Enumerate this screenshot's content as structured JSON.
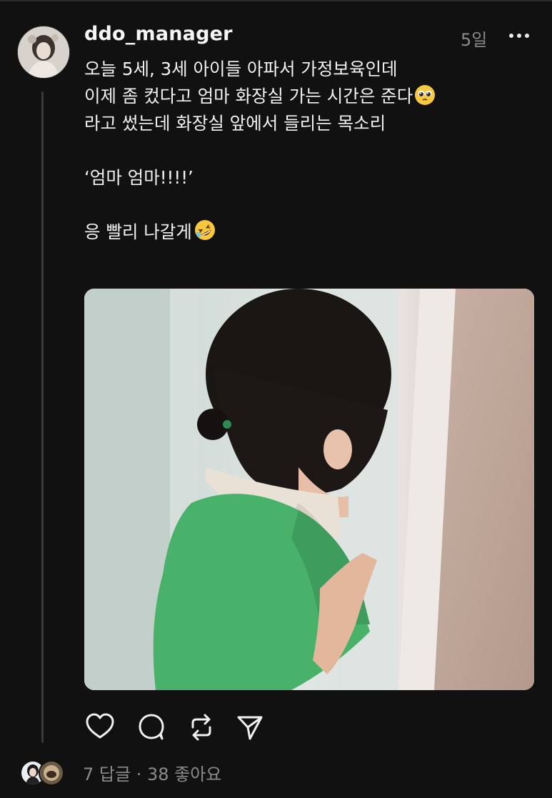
{
  "post": {
    "username": "ddo_manager",
    "time_ago": "5일",
    "text": {
      "line1": "오늘 5세, 3세 아이들 아파서 가정보육인데",
      "line2": "이제 좀 컸다고 엄마 화장실 가는 시간은 준다",
      "line3": "라고 썼는데 화장실 앞에서 들리는 목소리",
      "line4": "‘엄마 엄마!!!!’",
      "line5": "응 빨리 나갈게"
    },
    "emojis": {
      "line2_end": "pleading-face",
      "line5_end": "rolling-on-floor-laughing-face"
    }
  },
  "actions": {
    "like": "heart-icon",
    "reply": "comment-bubble-icon",
    "repost": "repost-arrows-icon",
    "share": "send-paper-plane-icon"
  },
  "stats": {
    "replies": "7 답글",
    "separator": "·",
    "likes": "38 좋아요"
  },
  "colors": {
    "background": "#111111",
    "text": "#f2f2f2",
    "muted": "#8b8b8b",
    "shirt_green": "#49b26a"
  }
}
